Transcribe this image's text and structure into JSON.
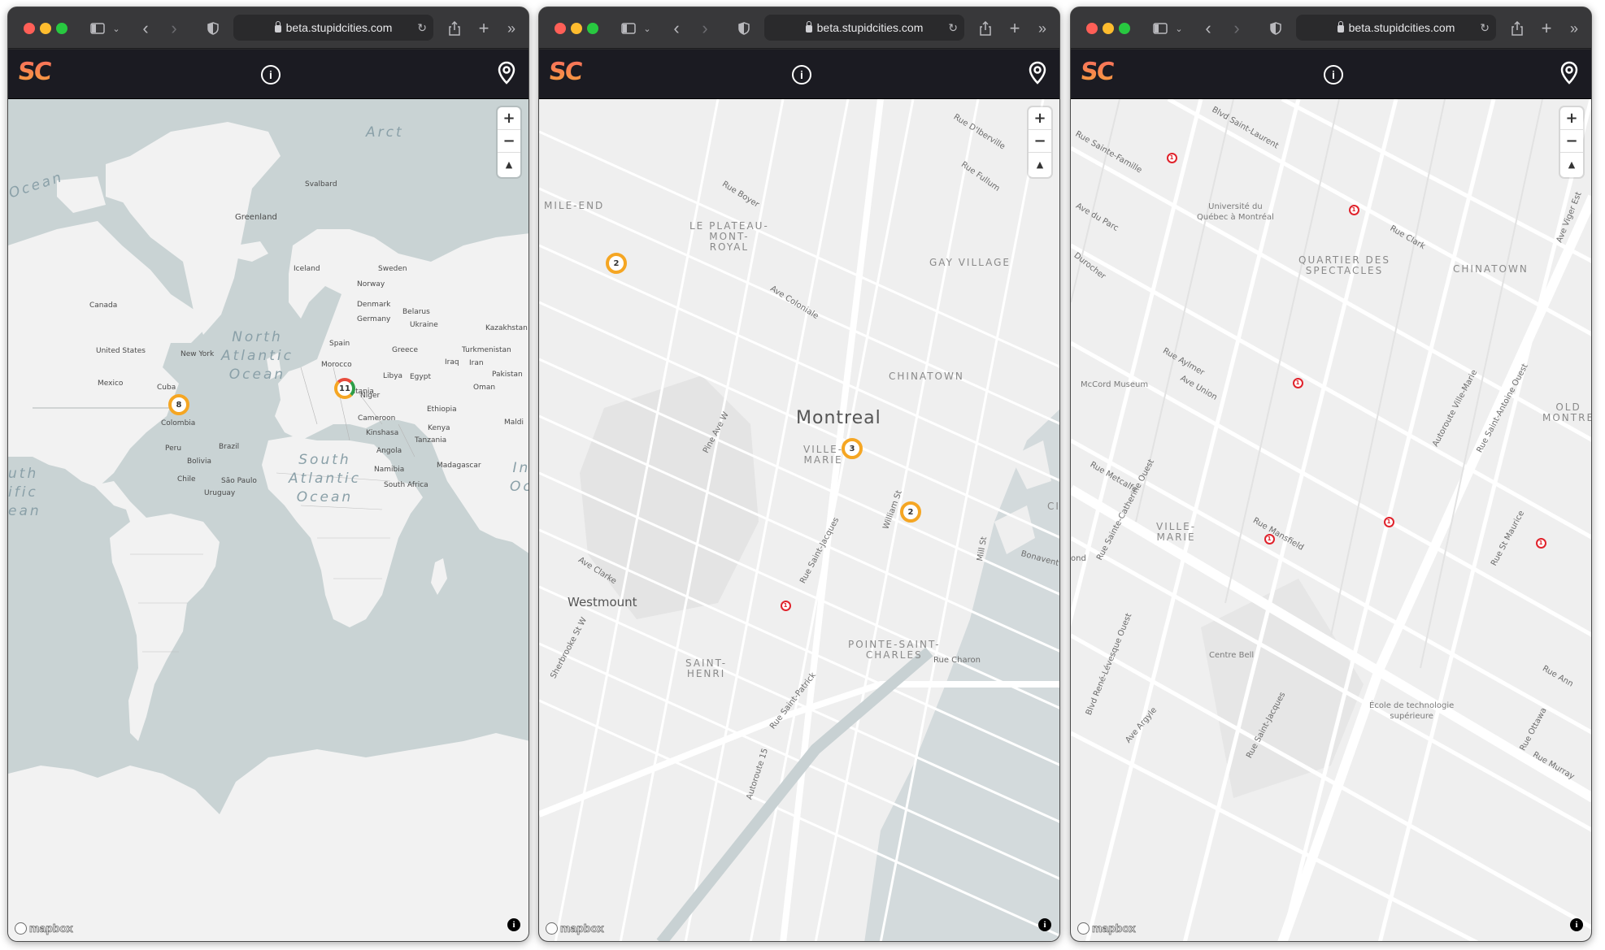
{
  "browser": {
    "url": "beta.stupidcities.com"
  },
  "app": {
    "logo": "SC",
    "info_glyph": "i",
    "map_attribution": "mapbox",
    "zoom_in": "+",
    "zoom_out": "−",
    "compass": "▲",
    "info_button": "i"
  },
  "windows": [
    {
      "view": "world",
      "labels": {
        "arctic": "Arct",
        "ocean_left": "Ocean",
        "svalbard": "Svalbard",
        "greenland": "Greenland",
        "iceland": "Iceland",
        "sweden": "Sweden",
        "norway": "Norway",
        "denmark": "Denmark",
        "belarus": "Belarus",
        "canada": "Canada",
        "germany": "Germany",
        "ukraine": "Ukraine",
        "kazakhstan": "Kazakhstan",
        "north_atlantic": "North\nAtlantic\nOcean",
        "united_states": "United States",
        "new_york": "New York",
        "spain": "Spain",
        "greece": "Greece",
        "turkmenistan": "Turkmenistan",
        "morocco": "Morocco",
        "iraq": "Iraq",
        "iran": "Iran",
        "libya": "Libya",
        "egypt": "Egypt",
        "pakistan": "Pakistan",
        "mexico": "Mexico",
        "cuba": "Cuba",
        "oman": "Oman",
        "mauritania": "Mauritania",
        "niger": "Niger",
        "ethiopia": "Ethiopia",
        "colombia": "Colombia",
        "cameroon": "Cameroon",
        "maldives": "Maldi",
        "kinshasa": "Kinshasa",
        "kenya": "Kenya",
        "tanzania": "Tanzania",
        "peru": "Peru",
        "brazil": "Brazil",
        "angola": "Angola",
        "bolivia": "Bolivia",
        "south_atlantic": "South\nAtlantic\nOcean",
        "namibia": "Namibia",
        "madagascar": "Madagascar",
        "indian": "In\nOc",
        "chile": "Chile",
        "sao_paulo": "São Paulo",
        "south_africa": "South Africa",
        "uruguay": "Uruguay",
        "pacific_left": "uth\nific\nean"
      },
      "clusters": [
        {
          "count": "8"
        },
        {
          "count": "11"
        }
      ]
    },
    {
      "view": "montreal",
      "labels": {
        "mile_end": "MILE-END",
        "plateau": "LE PLATEAU-\nMONT-\nROYAL",
        "gay_village": "GAY VILLAGE",
        "chinatown": "CHINATOWN",
        "montreal": "Montreal",
        "ville_marie": "VILLE-\nMARIE",
        "westmount": "Westmount",
        "saint_henri": "SAINT-\nHENRI",
        "pointe_saint_charles": "POINTE-SAINT-\nCHARLES",
        "rue_diberville": "Rue D'Iberville",
        "rue_fullum": "Rue Fullum",
        "rue_boyer": "Rue Boyer",
        "ave_coloniale": "Ave Coloniale",
        "pine_ave": "Pine Ave W",
        "rue_saint_jacques": "Rue Saint-Jacques",
        "william_st": "William St",
        "mill_st": "Mill St",
        "bonaventure": "Bonavent",
        "ave_clarke": "Ave Clarke",
        "sherbrooke": "Sherbrooke St W",
        "rue_saint_patrick": "Rue Saint-Patrick",
        "autoroute_15": "Autoroute 15",
        "rue_charon": "Rue Charon",
        "cit": "CIT"
      },
      "clusters": [
        {
          "count": "2"
        },
        {
          "count": "3"
        },
        {
          "count": "2"
        }
      ],
      "markers": [
        {
          "count": "1"
        }
      ]
    },
    {
      "view": "downtown",
      "labels": {
        "blvd_saint_laurent": "Blvd Saint-Laurent",
        "rue_sainte_famille": "Rue Sainte-Famille",
        "uqam": "Université du\nQuébec à Montréal",
        "ave_du_parc": "Ave du Parc",
        "rue_clark": "Rue Clark",
        "ave_viger": "Ave Viger Est",
        "durocher": "Durocher",
        "quartier": "QUARTIER DES\nSPECTACLES",
        "chinatown": "CHINATOWN",
        "rue_aylmer": "Rue Aylmer",
        "ave_union": "Ave Union",
        "mccord": "McCord Museum",
        "autoroute_ville_marie": "Autoroute Ville-Marie",
        "rue_saint_antoine": "Rue Saint-Antoine Ouest",
        "old_montreal": "OLD\nMONTRE",
        "rue_metcalfe": "Rue Metcalfe",
        "rue_sainte_catherine": "Rue Sainte-Catherine Ouest",
        "ville_marie": "VILLE-\nMARIE",
        "rue_mansfield": "Rue Mansfield",
        "rue_st_maurice": "Rue St Maurice",
        "centre_bell": "Centre Bell",
        "blvd_rene_levesque": "Blvd René-Lévesque Ouest",
        "rue_ann": "Rue Ann",
        "ets": "École de technologie\nsupérieure",
        "ave_argyle": "Ave Argyle",
        "rue_saint_jacques": "Rue Saint-Jacques",
        "rue_ottawa": "Rue Ottawa",
        "rue_murray": "Rue Murray",
        "ond": "ond"
      },
      "markers": [
        {
          "count": "1"
        },
        {
          "count": "1"
        },
        {
          "count": "1"
        },
        {
          "count": "1"
        },
        {
          "count": "1"
        },
        {
          "count": "1"
        }
      ]
    }
  ]
}
